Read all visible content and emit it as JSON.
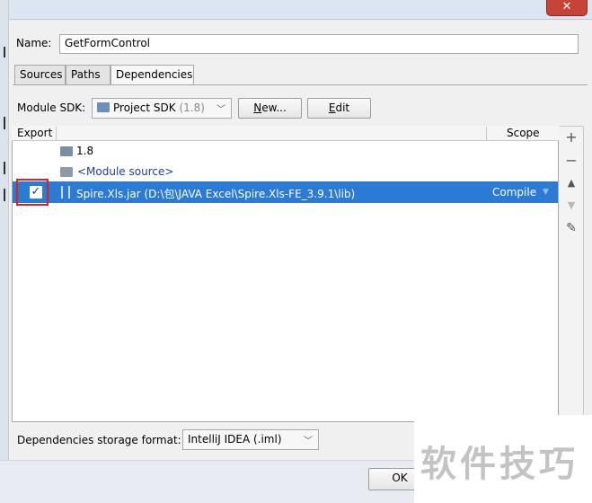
{
  "window": {
    "close_glyph": "✕"
  },
  "name_row": {
    "label": "Name:",
    "value": "GetFormControl"
  },
  "tabs": [
    {
      "label": "Sources"
    },
    {
      "label": "Paths"
    },
    {
      "label": "Dependencies",
      "selected": true
    }
  ],
  "sdk": {
    "label": "Module SDK:",
    "selected_name": "Project SDK",
    "selected_version": "(1.8)",
    "new_button_u": "N",
    "new_button_rest": "ew...",
    "edit_button_u": "E",
    "edit_button_rest": "dit"
  },
  "table": {
    "col_export": "Export",
    "col_scope": "Scope",
    "rows": [
      {
        "icon": "jdk-folder-icon",
        "text": "1.8"
      },
      {
        "icon": "module-source-icon",
        "text": "<Module source>"
      },
      {
        "icon": "jar-library-icon",
        "text": "Spire.Xls.jar (D:\\包\\JAVA Excel\\Spire.Xls-FE_3.9.1\\lib)",
        "scope": "Compile",
        "export_checked": true,
        "selected": true
      }
    ]
  },
  "toolbar": {
    "add": "+",
    "remove": "−",
    "up": "▲",
    "down": "▼",
    "edit": "✎"
  },
  "storage": {
    "label": "Dependencies storage format:",
    "value": "IntelliJ IDEA (.iml)"
  },
  "footer": {
    "ok_label": "OK"
  },
  "watermark": {
    "text": "软件技巧"
  },
  "colors": {
    "selection": "#2b7bd4",
    "highlight_box": "#e0201c"
  }
}
